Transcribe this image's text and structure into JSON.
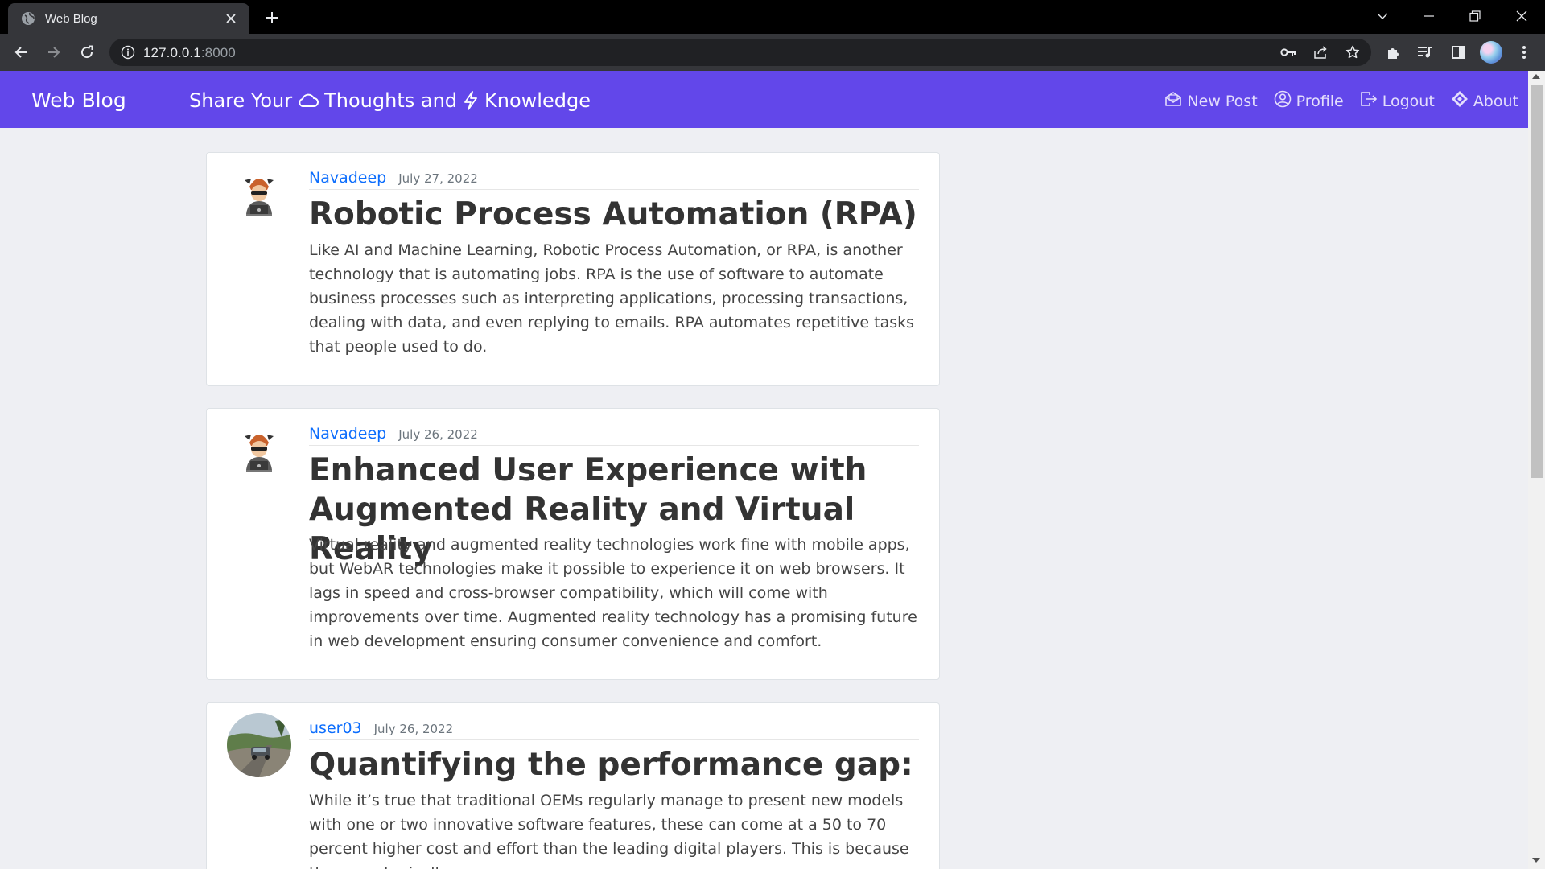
{
  "browser": {
    "tab_title": "Web Blog",
    "url_host": "127.0.0.1",
    "url_port": ":8000"
  },
  "navbar": {
    "brand": "Web Blog",
    "tagline_part1": "Share Your",
    "tagline_part2": "Thoughts and",
    "tagline_part3": "Knowledge",
    "links": [
      {
        "label": "New Post",
        "icon": "envelope-open-icon"
      },
      {
        "label": "Profile",
        "icon": "person-circle-icon"
      },
      {
        "label": "Logout",
        "icon": "box-arrow-right-icon"
      },
      {
        "label": "About",
        "icon": "diamond-icon"
      }
    ]
  },
  "posts": [
    {
      "author": "Navadeep",
      "date": "July 27, 2022",
      "title": "Robotic Process Automation (RPA)",
      "body": "Like AI and Machine Learning, Robotic Process Automation, or RPA, is another technology that is automating jobs. RPA is the use of software to automate business processes such as interpreting applications, processing transactions, dealing with data, and even replying to emails. RPA automates repetitive tasks that people used to do."
    },
    {
      "author": "Navadeep",
      "date": "July 26, 2022",
      "title": "Enhanced User Experience with Augmented Reality and Virtual Reality",
      "body": "Virtual reality and augmented reality technologies work fine with mobile apps, but WebAR technologies make it possible to experience it on web browsers. It lags in speed and cross-browser compatibility, which will come with improvements over time. Augmented reality technology has a promising future in web development ensuring consumer convenience and comfort."
    },
    {
      "author": "user03",
      "date": "July 26, 2022",
      "title": "Quantifying the performance gap:",
      "body": "While it’s true that traditional OEMs regularly manage to present new models with one or two innovative software features, these can come at a 50 to 70 percent higher cost and effort than the leading digital players. This is because there are typically"
    }
  ],
  "colors": {
    "navbar": "#6247ea",
    "author_link": "#0d6efd",
    "page_bg": "#eeeff3"
  }
}
